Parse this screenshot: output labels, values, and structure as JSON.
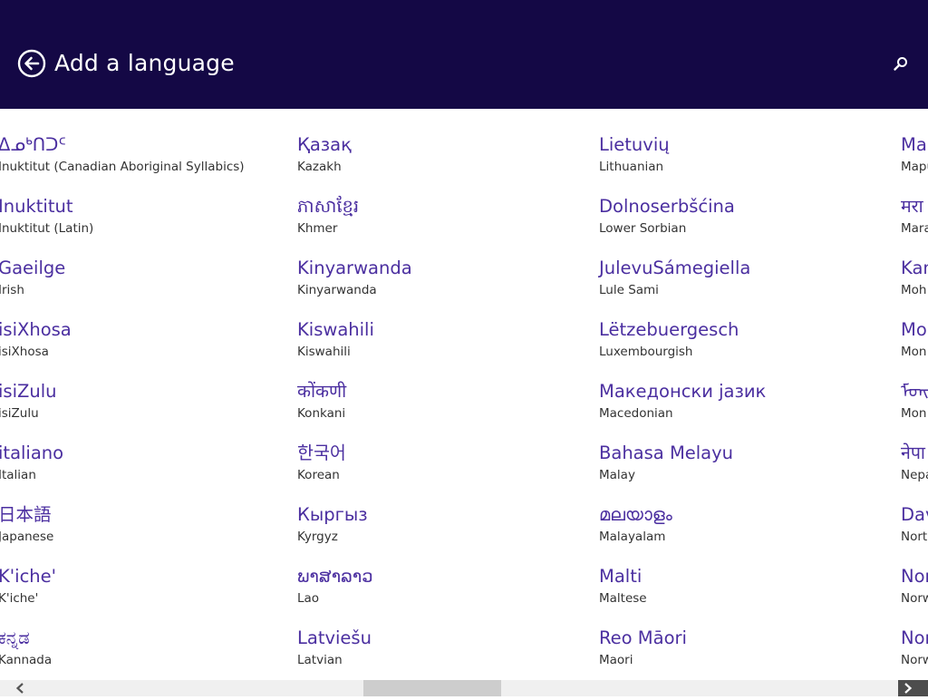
{
  "header": {
    "title": "Add a language",
    "back_icon": "back-arrow-circle-icon",
    "search_icon": "search-icon",
    "background": "#140845"
  },
  "colors": {
    "native_text": "#4b2fa0",
    "english_text": "#333333",
    "scroll_track": "#f0f0f0",
    "scroll_thumb": "#cdcdcd",
    "scroll_arrow_active": "#4d4d4d"
  },
  "columns": [
    {
      "items": [
        {
          "native": "ᐃᓄᒃᑎᑐᑦ",
          "english": "Inuktitut (Canadian Aboriginal Syllabics)"
        },
        {
          "native": "Inuktitut",
          "english": "Inuktitut (Latin)"
        },
        {
          "native": "Gaeilge",
          "english": "Irish"
        },
        {
          "native": "isiXhosa",
          "english": "isiXhosa"
        },
        {
          "native": "isiZulu",
          "english": "isiZulu"
        },
        {
          "native": "italiano",
          "english": "Italian"
        },
        {
          "native": "日本語",
          "english": "Japanese"
        },
        {
          "native": "K'iche'",
          "english": "K'iche'"
        },
        {
          "native": "ಕನ್ನಡ",
          "english": "Kannada"
        }
      ]
    },
    {
      "items": [
        {
          "native": "Қазақ",
          "english": "Kazakh"
        },
        {
          "native": "ភាសាខ្មែរ",
          "english": "Khmer"
        },
        {
          "native": "Kinyarwanda",
          "english": "Kinyarwanda"
        },
        {
          "native": "Kiswahili",
          "english": "Kiswahili"
        },
        {
          "native": "कोंकणी",
          "english": "Konkani"
        },
        {
          "native": "한국어",
          "english": "Korean"
        },
        {
          "native": "Кыргыз",
          "english": "Kyrgyz"
        },
        {
          "native": "ພາສາລາວ",
          "english": "Lao"
        },
        {
          "native": "Latviešu",
          "english": "Latvian"
        }
      ]
    },
    {
      "items": [
        {
          "native": "Lietuvių",
          "english": "Lithuanian"
        },
        {
          "native": "Dolnoserbšćina",
          "english": "Lower Sorbian"
        },
        {
          "native": "JulevuSámegiella",
          "english": "Lule Sami"
        },
        {
          "native": "Lëtzebuergesch",
          "english": "Luxembourgish"
        },
        {
          "native": "Македонски јазик",
          "english": "Macedonian"
        },
        {
          "native": "Bahasa Melayu",
          "english": "Malay"
        },
        {
          "native": "മലയാളം",
          "english": "Malayalam"
        },
        {
          "native": "Malti",
          "english": "Maltese"
        },
        {
          "native": "Reo Māori",
          "english": "Maori"
        }
      ]
    },
    {
      "items": [
        {
          "native": "Ma",
          "english": "Mapu"
        },
        {
          "native": "मरा",
          "english": "Mara"
        },
        {
          "native": "Kan",
          "english": "Moh"
        },
        {
          "native": "Mo",
          "english": "Mon"
        },
        {
          "native": "ᠮᠣᠩ",
          "english": "Mon"
        },
        {
          "native": "नेपा",
          "english": "Nepa"
        },
        {
          "native": "Dav",
          "english": "Nort"
        },
        {
          "native": "Nor",
          "english": "Norw"
        },
        {
          "native": "Nor",
          "english": "Norw"
        }
      ]
    }
  ],
  "scrollbar": {
    "left_icon": "chevron-left-icon",
    "right_icon": "chevron-right-icon",
    "position": 0.45,
    "visible_fraction": 0.16
  }
}
